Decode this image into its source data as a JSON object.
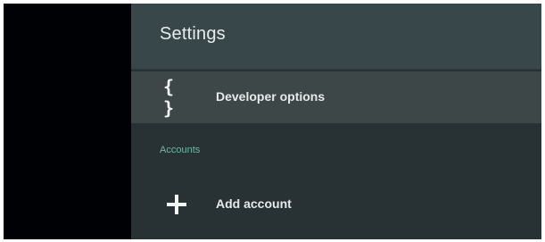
{
  "settings": {
    "title": "Settings",
    "items": [
      {
        "label": "Developer options",
        "icon": "braces-icon",
        "selected": true
      }
    ],
    "sections": [
      {
        "header": "Accounts",
        "items": [
          {
            "label": "Add account",
            "icon": "plus-icon"
          }
        ]
      }
    ]
  },
  "colors": {
    "header_bg": "#37474a",
    "panel_bg": "#283133",
    "selected_row": "#3d4748",
    "section_accent": "#6fb7a8"
  }
}
